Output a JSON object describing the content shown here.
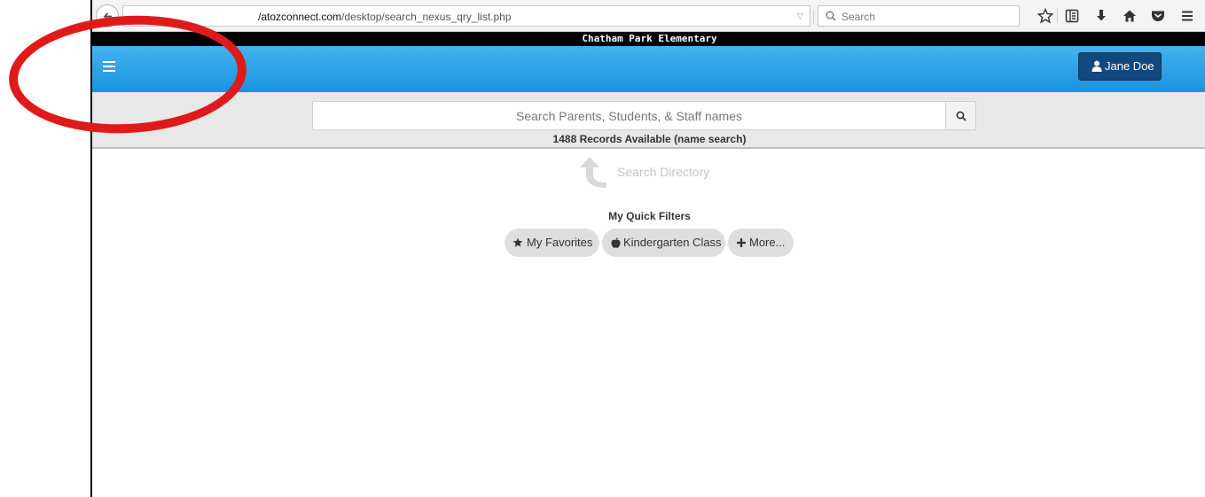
{
  "browser": {
    "url_prefix": "/atozconnect.com",
    "url_path": "/desktop/search_nexus_qry_list.php",
    "search_placeholder": "Search"
  },
  "app": {
    "school_name": "Chatham Park Elementary",
    "user_name": "Jane Doe"
  },
  "search": {
    "placeholder": "Search Parents, Students, & Staff names",
    "records_text": "1488 Records Available (name search)"
  },
  "hint": {
    "text": "Search Directory"
  },
  "quick_filters": {
    "title": "My Quick Filters",
    "items": [
      {
        "label": "My Favorites",
        "icon": "star-icon"
      },
      {
        "label": "Kindergarten Class",
        "icon": "apple-icon"
      },
      {
        "label": "More...",
        "icon": "plus-icon"
      }
    ]
  },
  "colors": {
    "header_blue": "#1a93e0",
    "user_button": "#12487f",
    "annotation_red": "#e01a1a"
  }
}
